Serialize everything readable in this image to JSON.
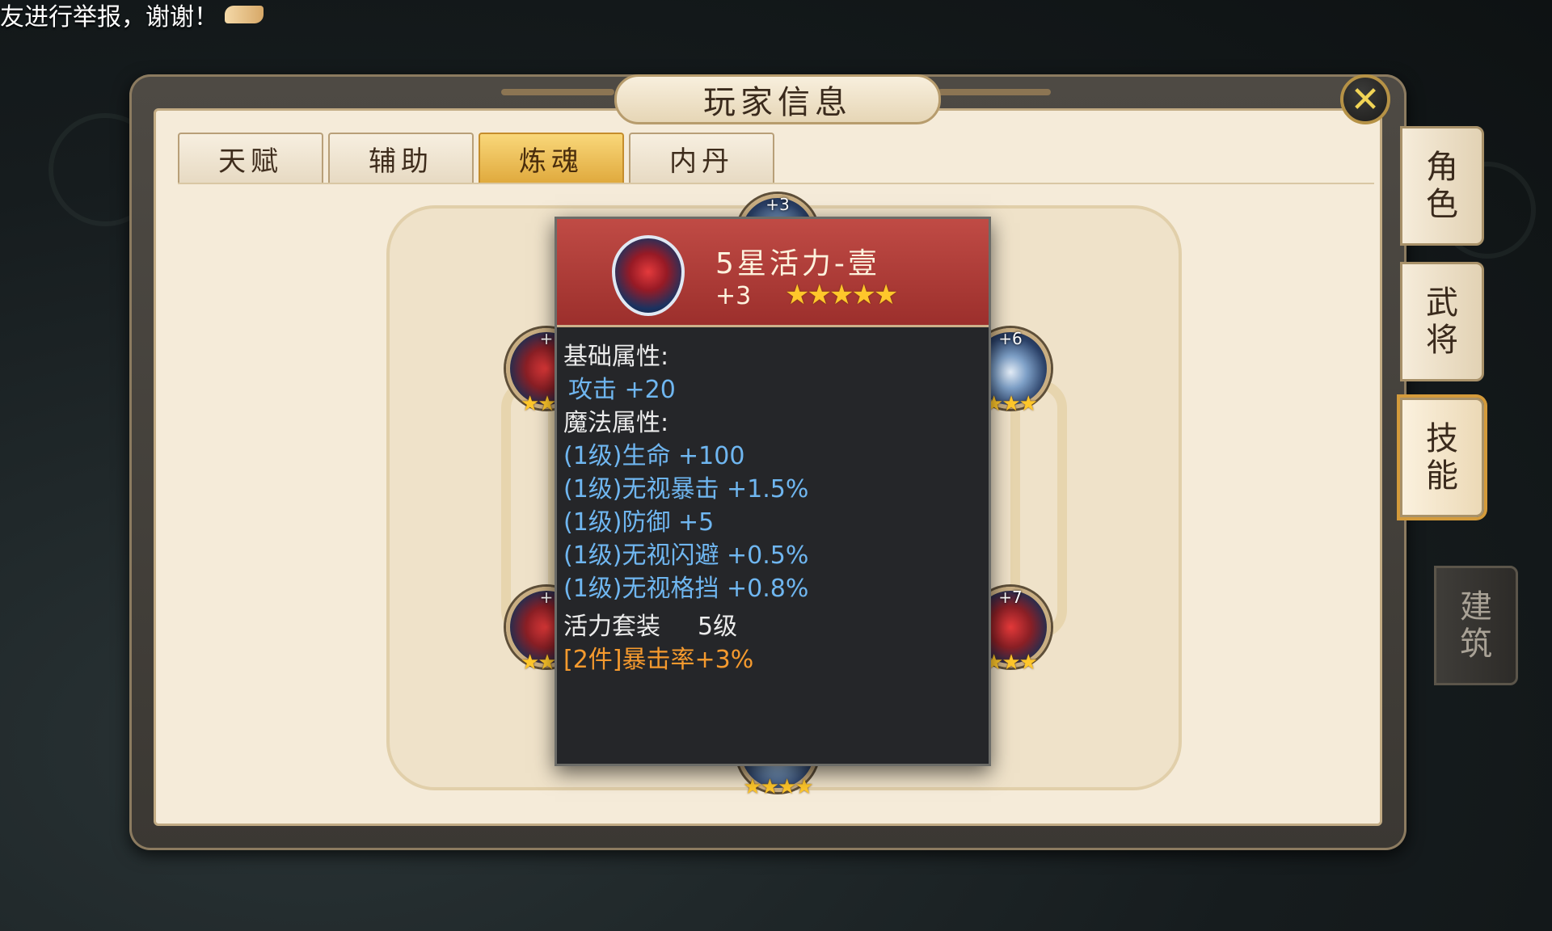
{
  "marquee": {
    "text": "友进行举报，谢谢！",
    "icon": "handshake-icon"
  },
  "window": {
    "title": "玩家信息",
    "close_icon": "close-icon"
  },
  "tabs": [
    {
      "label": "天赋",
      "active": false
    },
    {
      "label": "辅助",
      "active": false
    },
    {
      "label": "炼魂",
      "active": true
    },
    {
      "label": "内丹",
      "active": false
    }
  ],
  "side_tabs": [
    {
      "label_1": "角",
      "label_2": "色",
      "active": false
    },
    {
      "label_1": "武",
      "label_2": "将",
      "active": false
    },
    {
      "label_1": "技",
      "label_2": "能",
      "active": true
    },
    {
      "label_1": "建",
      "label_2": "筑",
      "active": false
    }
  ],
  "orbs": {
    "top": {
      "level": "+3",
      "stars": "★★★"
    },
    "left_top": {
      "level": "+",
      "stars": "★★★"
    },
    "right_top": {
      "level": "+6",
      "stars": "★★★"
    },
    "left_bottom": {
      "level": "+",
      "stars": "★★★"
    },
    "right_bottom": {
      "level": "+7",
      "stars": "★★★"
    },
    "bottom": {
      "level": "",
      "stars": "★★★★"
    }
  },
  "tooltip": {
    "name": "5星活力-壹",
    "level": "+3",
    "stars": "★★★★★",
    "base_title": "基础属性:",
    "base_attr": "攻击 +20",
    "magic_title": "魔法属性:",
    "magic_attrs": [
      "(1级)生命 +100",
      "(1级)无视暴击 +1.5%",
      "(1级)防御 +5",
      "(1级)无视闪避 +0.5%",
      "(1级)无视格挡 +0.8%"
    ],
    "set_name": "活力套装",
    "set_level": "5级",
    "set_bonus": "[2件]暴击率+3%"
  },
  "colors": {
    "accent_gold": "#e0aa3e",
    "tooltip_header": "#9c2f2c",
    "attr_blue": "#6fb6f0",
    "set_orange": "#f59a2e",
    "star": "#ffc72b"
  }
}
